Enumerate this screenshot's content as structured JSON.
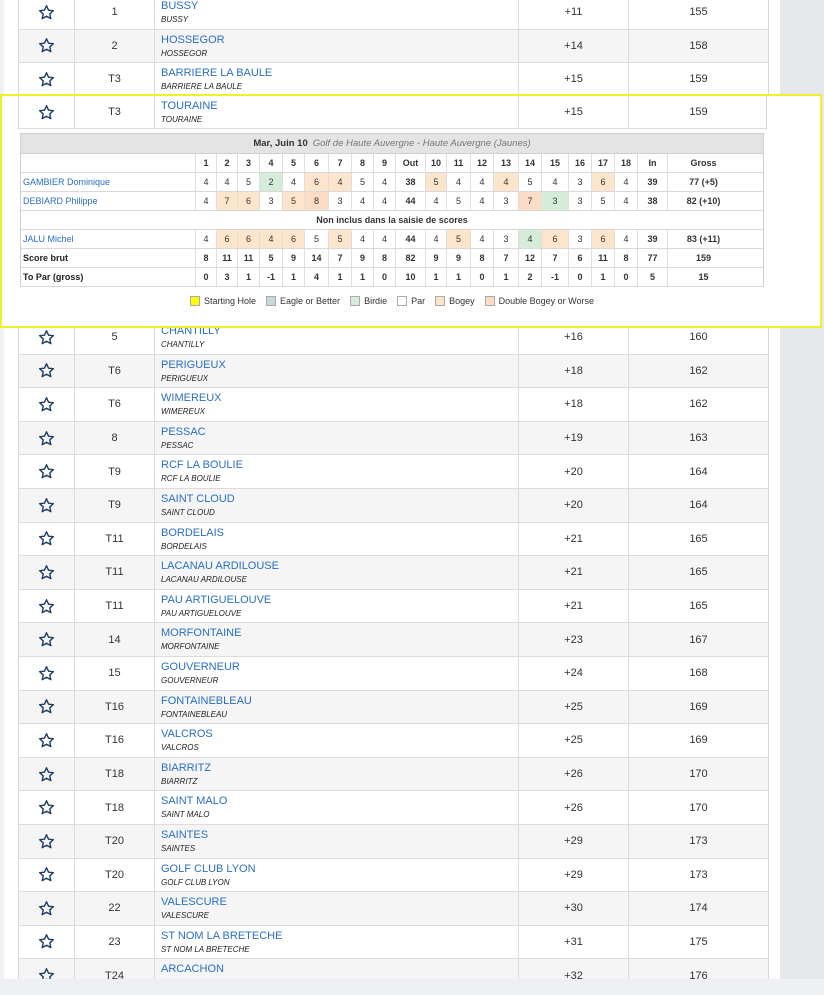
{
  "colors": {
    "accent_link": "#2a6fbf",
    "highlight_border": "#f1f12b",
    "starting_hole": "#ffff00",
    "eagle": "#c6d8dd",
    "birdie": "#d5ecd9",
    "par": "#ffffff",
    "bogey": "#fde5cc",
    "double_bogey": "#fbdcc4"
  },
  "top_rows": [
    {
      "pos": "1",
      "team": "BUSSY",
      "sub": "BUSSY",
      "par": "+11",
      "gross": "155"
    },
    {
      "pos": "2",
      "team": "HOSSEGOR",
      "sub": "HOSSEGOR",
      "par": "+14",
      "gross": "158"
    },
    {
      "pos": "T3",
      "team": "BARRIERE LA BAULE",
      "sub": "BARRIERE LA BAULE",
      "par": "+15",
      "gross": "159"
    }
  ],
  "selected_row": {
    "pos": "T3",
    "team": "TOURAINE",
    "sub": "TOURAINE",
    "par": "+15",
    "gross": "159"
  },
  "scorecard": {
    "date": "Mar, Juin 10",
    "course": "Golf de Haute Auvergne - Haute Auvergne (Jaunes)",
    "columns": [
      "1",
      "2",
      "3",
      "4",
      "5",
      "6",
      "7",
      "8",
      "9",
      "Out",
      "10",
      "11",
      "12",
      "13",
      "14",
      "15",
      "16",
      "17",
      "18",
      "In",
      "Gross"
    ],
    "players": [
      {
        "name": "GAMBIER Dominique",
        "scores": [
          "4",
          "4",
          "5",
          "2",
          "4",
          "6",
          "4",
          "5",
          "4",
          "38",
          "5",
          "4",
          "4",
          "4",
          "5",
          "4",
          "3",
          "6",
          "4",
          "39",
          "77 (+5)"
        ]
      },
      {
        "name": "DEBIARD Philippe",
        "scores": [
          "4",
          "7",
          "6",
          "3",
          "5",
          "8",
          "3",
          "4",
          "4",
          "44",
          "4",
          "5",
          "4",
          "3",
          "7",
          "3",
          "3",
          "5",
          "4",
          "38",
          "82 (+10)"
        ]
      }
    ],
    "note": "Non inclus dans la saisie de scores",
    "excluded": [
      {
        "name": "JALU Michel",
        "scores": [
          "4",
          "6",
          "6",
          "4",
          "6",
          "5",
          "5",
          "4",
          "4",
          "44",
          "4",
          "5",
          "4",
          "3",
          "4",
          "6",
          "3",
          "6",
          "4",
          "39",
          "83 (+11)"
        ]
      }
    ],
    "totals": [
      {
        "name": "Score brut",
        "scores": [
          "8",
          "11",
          "11",
          "5",
          "9",
          "14",
          "7",
          "9",
          "8",
          "82",
          "9",
          "9",
          "8",
          "7",
          "12",
          "7",
          "6",
          "11",
          "8",
          "77",
          "159"
        ]
      },
      {
        "name": "To Par (gross)",
        "scores": [
          "0",
          "3",
          "1",
          "-1",
          "1",
          "4",
          "1",
          "1",
          "0",
          "10",
          "1",
          "1",
          "0",
          "1",
          "2",
          "-1",
          "0",
          "1",
          "0",
          "5",
          "15"
        ]
      }
    ],
    "legend": [
      "Starting Hole",
      "Eagle or Better",
      "Birdie",
      "Par",
      "Bogey",
      "Double Bogey or Worse"
    ]
  },
  "bottom_rows": [
    {
      "pos": "5",
      "team": "CHANTILLY",
      "sub": "CHANTILLY",
      "par": "+16",
      "gross": "160"
    },
    {
      "pos": "T6",
      "team": "PERIGUEUX",
      "sub": "PERIGUEUX",
      "par": "+18",
      "gross": "162"
    },
    {
      "pos": "T6",
      "team": "WIMEREUX",
      "sub": "WIMEREUX",
      "par": "+18",
      "gross": "162"
    },
    {
      "pos": "8",
      "team": "PESSAC",
      "sub": "PESSAC",
      "par": "+19",
      "gross": "163"
    },
    {
      "pos": "T9",
      "team": "RCF LA BOULIE",
      "sub": "RCF LA BOULIE",
      "par": "+20",
      "gross": "164"
    },
    {
      "pos": "T9",
      "team": "SAINT CLOUD",
      "sub": "SAINT CLOUD",
      "par": "+20",
      "gross": "164"
    },
    {
      "pos": "T11",
      "team": "BORDELAIS",
      "sub": "BORDELAIS",
      "par": "+21",
      "gross": "165"
    },
    {
      "pos": "T11",
      "team": "LACANAU ARDILOUSE",
      "sub": "LACANAU ARDILOUSE",
      "par": "+21",
      "gross": "165"
    },
    {
      "pos": "T11",
      "team": "PAU ARTIGUELOUVE",
      "sub": "PAU ARTIGUELOUVE",
      "par": "+21",
      "gross": "165"
    },
    {
      "pos": "14",
      "team": "MORFONTAINE",
      "sub": "MORFONTAINE",
      "par": "+23",
      "gross": "167"
    },
    {
      "pos": "15",
      "team": "GOUVERNEUR",
      "sub": "GOUVERNEUR",
      "par": "+24",
      "gross": "168"
    },
    {
      "pos": "T16",
      "team": "FONTAINEBLEAU",
      "sub": "FONTAINEBLEAU",
      "par": "+25",
      "gross": "169"
    },
    {
      "pos": "T16",
      "team": "VALCROS",
      "sub": "VALCROS",
      "par": "+25",
      "gross": "169"
    },
    {
      "pos": "T18",
      "team": "BIARRITZ",
      "sub": "BIARRITZ",
      "par": "+26",
      "gross": "170"
    },
    {
      "pos": "T18",
      "team": "SAINT MALO",
      "sub": "SAINT MALO",
      "par": "+26",
      "gross": "170"
    },
    {
      "pos": "T20",
      "team": "SAINTES",
      "sub": "SAINTES",
      "par": "+29",
      "gross": "173"
    },
    {
      "pos": "T20",
      "team": "GOLF CLUB LYON",
      "sub": "GOLF CLUB LYON",
      "par": "+29",
      "gross": "173"
    },
    {
      "pos": "22",
      "team": "VALESCURE",
      "sub": "VALESCURE",
      "par": "+30",
      "gross": "174"
    },
    {
      "pos": "23",
      "team": "ST NOM LA BRETECHE",
      "sub": "ST NOM LA BRETECHE",
      "par": "+31",
      "gross": "175"
    },
    {
      "pos": "T24",
      "team": "ARCACHON",
      "sub": "ARCACHON",
      "par": "+32",
      "gross": "176"
    }
  ]
}
